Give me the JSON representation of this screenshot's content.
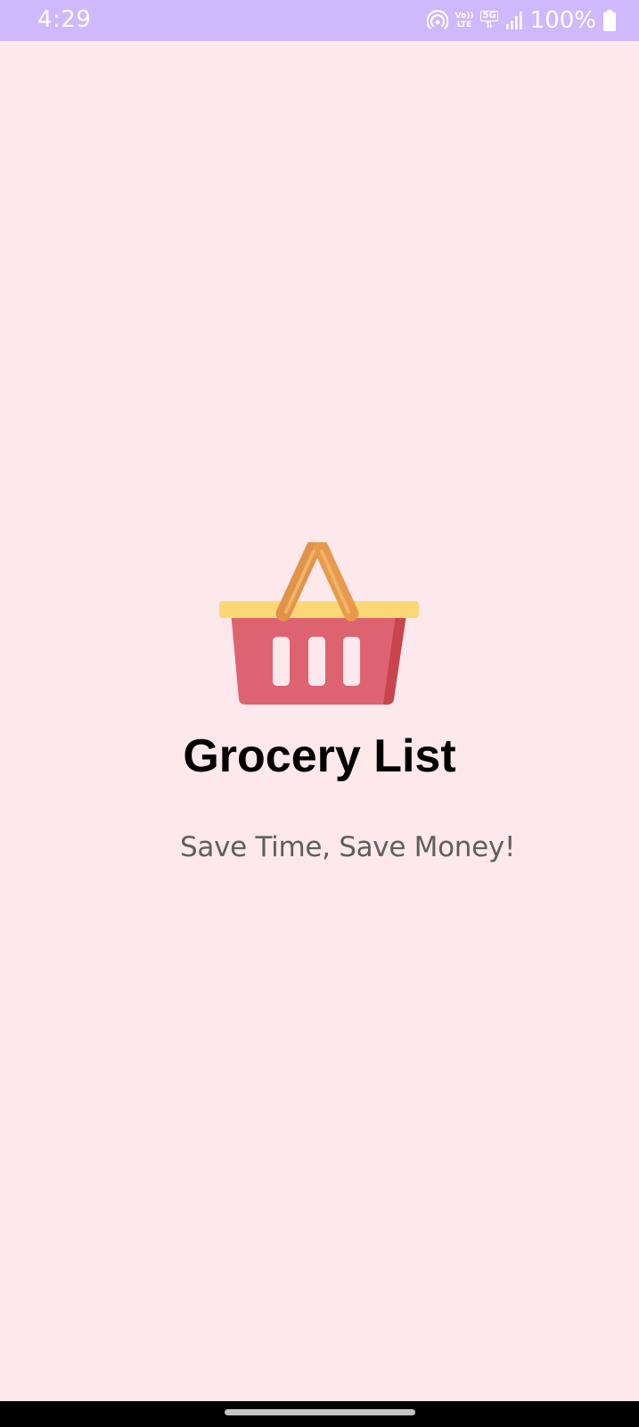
{
  "status_bar": {
    "time": "4:29",
    "volte_top": "Vo))",
    "volte_bottom": "LTE",
    "network": "5G",
    "battery_percent": "100%"
  },
  "splash": {
    "logo_icon": "shopping-basket-icon",
    "title": "Grocery List",
    "tagline": "Save Time, Save Money!"
  },
  "colors": {
    "status_bar": "#cfb8fb",
    "background": "#fde8ec",
    "basket_body": "#de6370",
    "basket_rim": "#fbd776",
    "basket_handle": "#e89a4c"
  }
}
